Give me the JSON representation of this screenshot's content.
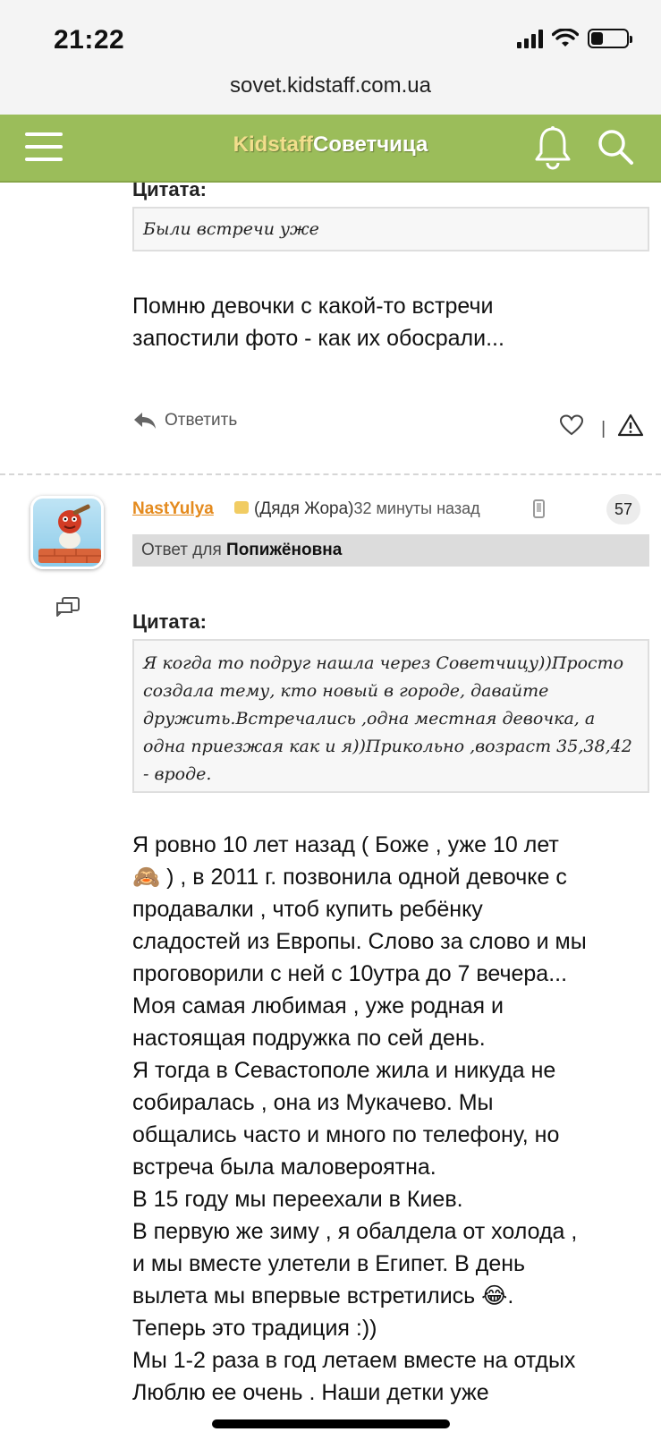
{
  "status_bar": {
    "time": "21:22",
    "battery_level": 0.35
  },
  "browser": {
    "url": "sovet.kidstaff.com.ua"
  },
  "header": {
    "logo_part1": "Kidstaff",
    "logo_part2": "Советчица",
    "icons": [
      "menu-icon",
      "bell-icon",
      "search-icon"
    ]
  },
  "prev_post": {
    "quote_label": "Цитата:",
    "quote_text": "Были встречи уже",
    "text_lines": [
      "Помню девочки с какой-то встречи",
      "запостили фото - как их обосрали..."
    ],
    "reply_label": "Ответить",
    "divider": "|"
  },
  "post": {
    "author": "NastYulya",
    "author_status": "(Дядя Жора)",
    "time": "32 минуты назад",
    "number": "57",
    "reply_to_prefix": "Ответ для",
    "reply_to_name": "Попижёновна",
    "quote_label": "Цитата:",
    "quote_text": "Я когда то подруг нашла через Советчицу))Просто создала тему, кто новый в городе, давайте дружить.Встречались ,одна местная девочка, а одна приезжая как и я))Прикольно ,возраст 35,38,42 - вроде.",
    "text_lines": [
      "Я ровно 10 лет назад ( Боже , уже 10 лет",
      "🙈 ) , в 2011 г. позвонила одной девочке с",
      "продавалки , чтоб купить ребёнку",
      "сладостей из Европы. Слово за слово и мы",
      "проговорили с ней с 10утра до 7 вечера...",
      "Моя самая любимая , уже родная и",
      "настоящая подружка по сей день.",
      "Я тогда в Севастополе жила и никуда не",
      "собиралась , она из Мукачево. Мы",
      "общались часто и много по телефону, но",
      "встреча была маловероятна.",
      "В 15 году мы переехали в Киев.",
      "В первую же зиму , я обалдела от холода ,",
      "и мы вместе улетели в Египет. В день",
      "вылета мы впервые встретились 😂.",
      "Теперь это традиция :))",
      "Мы 1-2 раза в год летаем вместе на отдых",
      "Люблю ее очень . Наши детки уже"
    ]
  },
  "colors": {
    "header_bg": "#9bbd5a",
    "author": "#e48a1d",
    "logo_accent": "#f2de8c"
  }
}
